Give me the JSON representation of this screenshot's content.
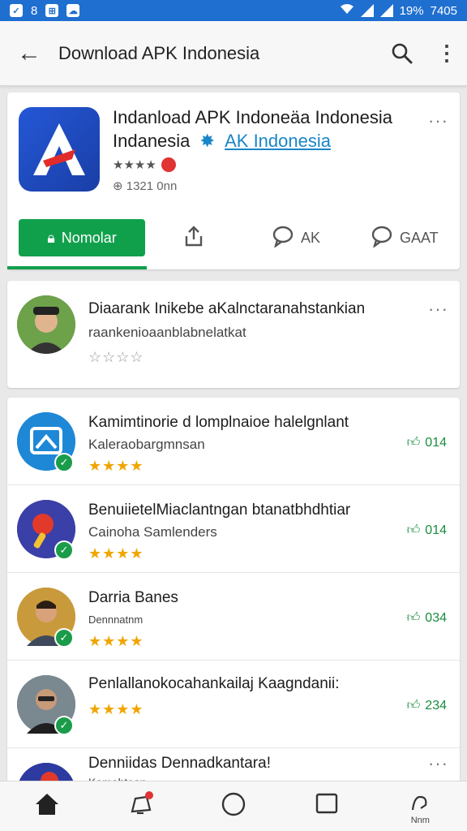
{
  "status_bar": {
    "icons_left": [
      "shield-icon",
      "grid-icon",
      "cloud-icon"
    ],
    "left_labels": [
      "8"
    ],
    "battery": "19%",
    "time": "7405",
    "icons_right": [
      "wifi-icon",
      "signal-icon",
      "signal-icon"
    ]
  },
  "app_bar": {
    "title": "Download APK Indonesia"
  },
  "app": {
    "title": "Indanload APK Indoneäa Indonesia Indanesia",
    "developer": "AK Indonesia",
    "rating_stars": "★★★★",
    "downloads": "1321 0nn",
    "install_label": "Nomolar",
    "share_label": "",
    "review_label": "AK",
    "chat_label": "GAAT",
    "colors": {
      "brand": "#1f6fd0",
      "install": "#10a04c",
      "link": "#1a86c7"
    }
  },
  "featured_review": {
    "name": "Diaarank Inikebe aKalnctaranahstankian",
    "text": "raankenioaanblabnelatkat",
    "stars": "☆☆☆☆"
  },
  "reviews": [
    {
      "name": "Kamimtinorie d lomplnaioe halelgnlant",
      "sub": "Kaleraobargmnsan",
      "stars": "★★★★",
      "likes": "014",
      "avatar": "app-icon"
    },
    {
      "name": "BenuiietelMiaclantngan btanatbhdhtiar",
      "sub": "Cainoha Samlenders",
      "stars": "★★★★",
      "likes": "014",
      "avatar": "app-icon"
    },
    {
      "name": "Darria Banes",
      "sub": "Dennnatnm",
      "stars": "★★★★",
      "likes": "034",
      "avatar": "person"
    },
    {
      "name": "Penlallanokocahankailaj Kaagndanii:",
      "sub": "",
      "stars": "★★★★",
      "likes": "234",
      "avatar": "person"
    },
    {
      "name": "Denniidas Dennadkantara!",
      "sub": "Kamahtean",
      "stars": "",
      "likes": "",
      "avatar": "app-icon"
    }
  ],
  "bottom_nav": {
    "items": [
      "home-icon",
      "notification-icon",
      "circle-icon",
      "square-icon",
      "profile-icon"
    ],
    "profile_label": "Nnm"
  }
}
